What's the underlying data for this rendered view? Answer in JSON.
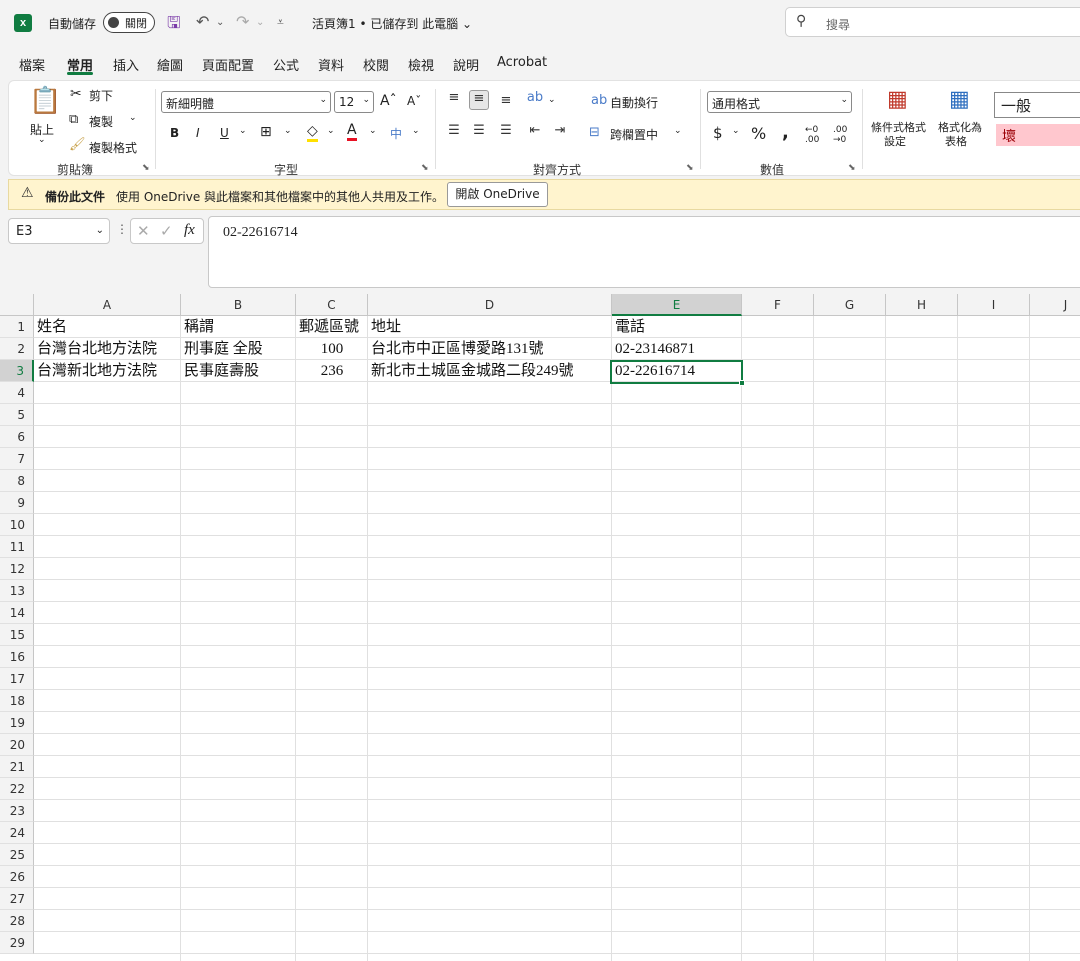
{
  "titlebar": {
    "autosave_label": "自動儲存",
    "autosave_state": "關閉",
    "doc_title": "活頁簿1 • 已儲存到 此電腦 ⌄",
    "search_placeholder": "搜尋"
  },
  "tabs": [
    "檔案",
    "常用",
    "插入",
    "繪圖",
    "頁面配置",
    "公式",
    "資料",
    "校閱",
    "檢視",
    "說明",
    "Acrobat"
  ],
  "active_tab": "常用",
  "ribbon": {
    "clipboard": {
      "paste": "貼上",
      "cut": "剪下",
      "copy": "複製",
      "format_painter": "複製格式",
      "group": "剪貼簿"
    },
    "font": {
      "name": "新細明體",
      "size": "12",
      "group": "字型"
    },
    "alignment": {
      "wrap": "自動換行",
      "merge": "跨欄置中",
      "group": "對齊方式"
    },
    "number": {
      "format": "通用格式",
      "group": "數值"
    },
    "styles": {
      "conditional": "條件式格式",
      "conditional2": "設定",
      "table": "格式化為",
      "table2": "表格",
      "normal": "一般",
      "bad": "壞"
    }
  },
  "infobar": {
    "title": "備份此文件",
    "message": "使用 OneDrive 與此檔案和其他檔案中的其他人共用及工作。",
    "button": "開啟 OneDrive"
  },
  "formula_bar": {
    "name_box": "E3",
    "content": "02-22616714"
  },
  "columns": [
    "A",
    "B",
    "C",
    "D",
    "E",
    "F",
    "G",
    "H",
    "I",
    "J"
  ],
  "rows": [
    "1",
    "2",
    "3",
    "4",
    "5",
    "6",
    "7",
    "8",
    "9",
    "10",
    "11",
    "12",
    "13",
    "14",
    "15",
    "16",
    "17",
    "18",
    "19",
    "20",
    "21",
    "22",
    "23",
    "24",
    "25",
    "26",
    "27",
    "28",
    "29"
  ],
  "cells": {
    "r1": [
      "姓名",
      "稱謂",
      "郵遞區號",
      "地址",
      "電話"
    ],
    "r2": [
      "台灣台北地方法院",
      "刑事庭 全股",
      "100",
      "台北市中正區博愛路131號",
      "02-23146871"
    ],
    "r3": [
      "台灣新北地方法院",
      "民事庭壽股",
      "236",
      "新北市土城區金城路二段249號",
      "02-22616714"
    ]
  },
  "selected_cell": "E3",
  "accent_color": "#107c41"
}
